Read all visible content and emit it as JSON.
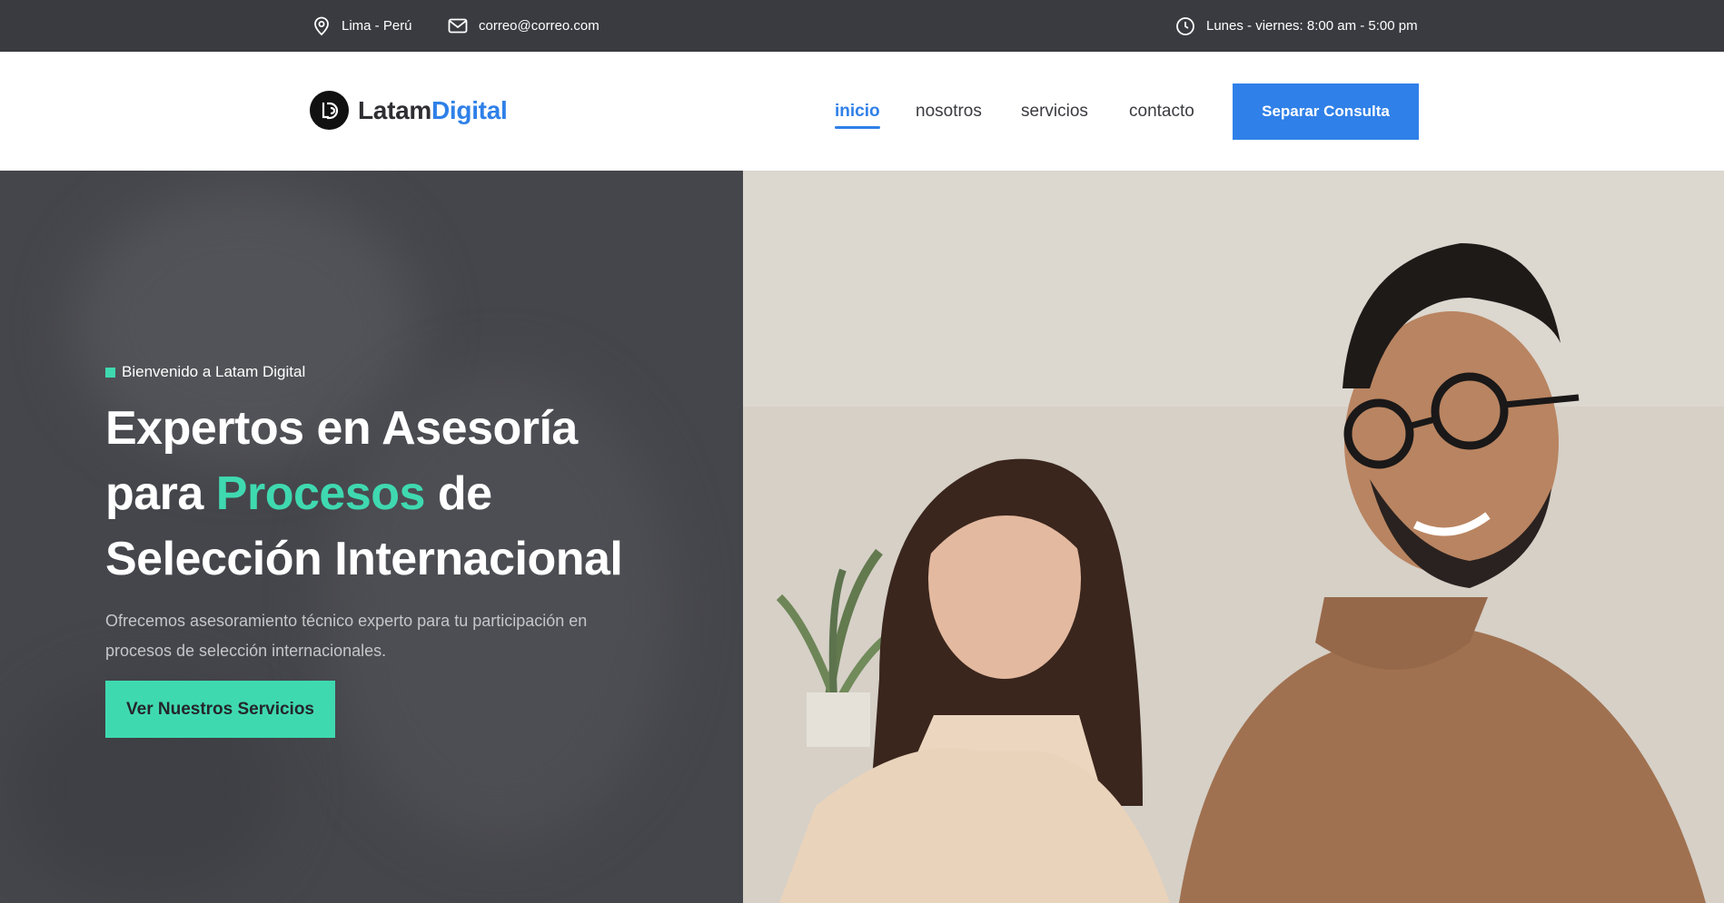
{
  "topbar": {
    "location": "Lima - Perú",
    "email": "correo@correo.com",
    "hours": "Lunes - viernes: 8:00 am - 5:00 pm",
    "icons": [
      "location-pin-icon",
      "mail-icon",
      "clock-icon"
    ]
  },
  "header": {
    "logo_part1": "Latam",
    "logo_part2": "Digital",
    "nav": [
      {
        "label": "inicio",
        "active": true
      },
      {
        "label": "nosotros"
      },
      {
        "label": "servicios"
      },
      {
        "label": "contacto"
      }
    ],
    "cta_label": "Separar Consulta"
  },
  "hero": {
    "tag": "Bienvenido a Latam Digital",
    "title_line1": "Expertos en Asesoría",
    "title_line2_a": "para ",
    "title_line2_highlight": "Procesos",
    "title_line2_b": " de",
    "title_line3": "Selección Internacional",
    "description": "Ofrecemos asesoramiento técnico experto para tu participación en procesos de selección internacionales.",
    "button_label": "Ver Nuestros Servicios"
  },
  "colors": {
    "topbar_bg": "#3a3b40",
    "brand_blue": "#2f80e8",
    "accent_green": "#3fd9b0",
    "hero_bg": "#45464b"
  }
}
